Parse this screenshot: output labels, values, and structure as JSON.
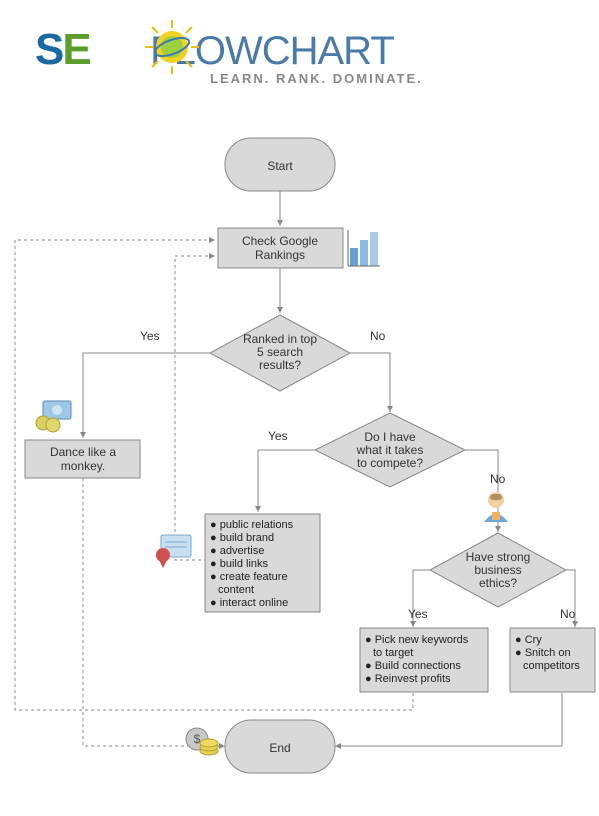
{
  "logo": {
    "seo_s": "S",
    "seo_e": "E",
    "flow": "FLOWCHART",
    "tagline": "LEARN. RANK. DOMINATE."
  },
  "nodes": {
    "start": "Start",
    "check": "Check Google\nRankings",
    "ranked": "Ranked in top\n5 search\nresults?",
    "dance": "Dance like a\nmonkey.",
    "compete": "Do I have\nwhat it takes\nto compete?",
    "ethics": "Have strong\nbusiness\nethics?",
    "end": "End"
  },
  "labels": {
    "yes": "Yes",
    "no": "No"
  },
  "list_compete": [
    "public relations",
    "build brand",
    "advertise",
    "build links",
    "create feature",
    "content",
    "interact online"
  ],
  "list_ethics_yes": [
    "Pick new keywords",
    "to target",
    "Build connections",
    "Reinvest profits"
  ],
  "list_ethics_no": [
    "Cry",
    "Snitch on",
    "competitors"
  ],
  "icons": {
    "chart": "chart-icon",
    "money": "money-icon",
    "cert": "certificate-icon",
    "person": "person-icon",
    "coins": "coins-icon",
    "sun": "sun-o-icon"
  }
}
